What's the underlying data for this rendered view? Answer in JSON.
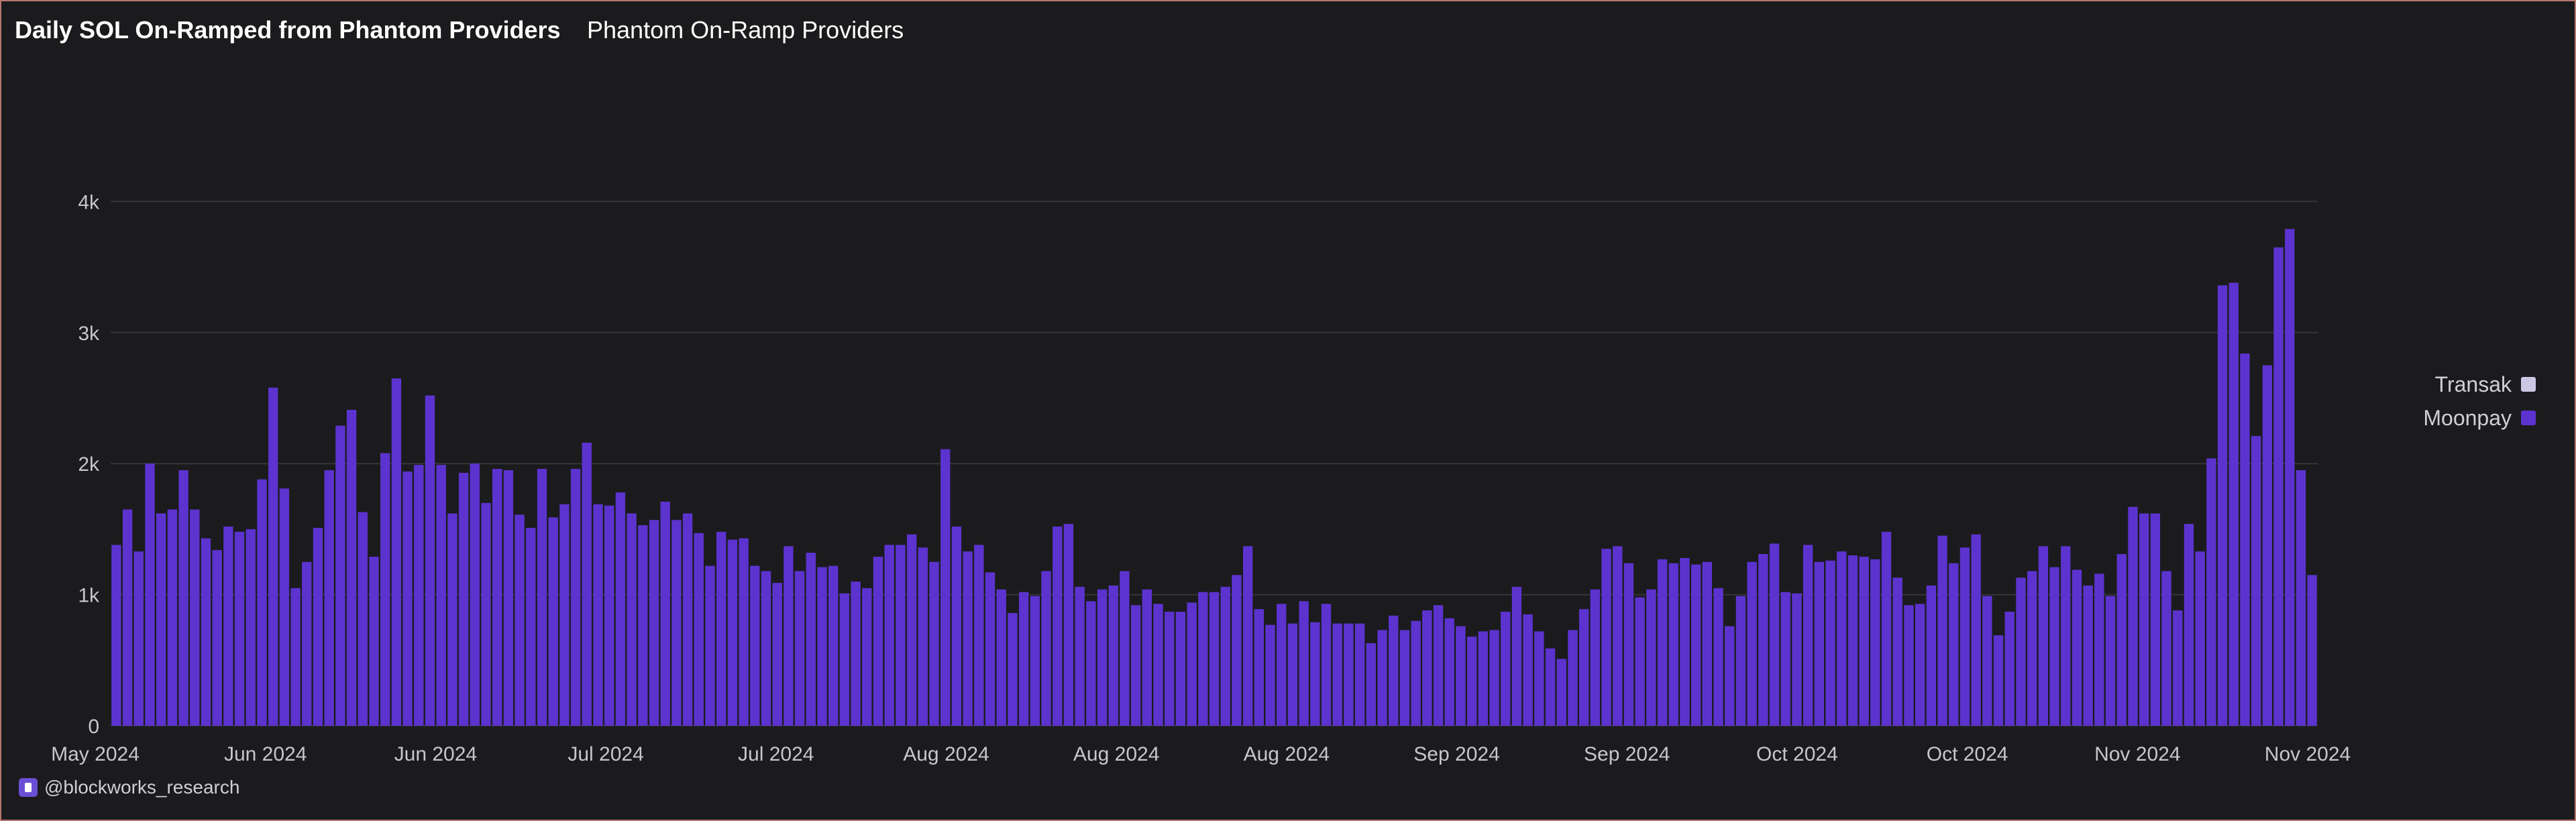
{
  "title": "Daily SOL On-Ramped from Phantom Providers",
  "subtitle": "Phantom On-Ramp Providers",
  "watermark": "@blockworks_research",
  "colors": {
    "background": "#1b1b1d",
    "grid": "#353538",
    "axis_text": "#c6c6cc",
    "moonpay": "#5c33cf",
    "transak": "#cbc6e4"
  },
  "chart_data": {
    "type": "bar",
    "stacked": true,
    "title": "Daily SOL On-Ramped from Phantom Providers",
    "subtitle": "Phantom On-Ramp Providers",
    "xlabel": "",
    "ylabel": "",
    "ylim": [
      0,
      5000
    ],
    "yticks": [
      0,
      1000,
      2000,
      3000,
      4000
    ],
    "ytick_labels": [
      "0",
      "1k",
      "2k",
      "3k",
      "4k"
    ],
    "xtick_labels": [
      "May 2024",
      "Jun 2024",
      "Jun 2024",
      "Jul 2024",
      "Jul 2024",
      "Aug 2024",
      "Aug 2024",
      "Aug 2024",
      "Sep 2024",
      "Sep 2024",
      "Oct 2024",
      "Oct 2024",
      "Nov 2024",
      "Nov 2024"
    ],
    "grid": true,
    "legend_position": "right",
    "series": [
      {
        "name": "Moonpay",
        "color": "#5c33cf",
        "values": [
          1380,
          1650,
          1330,
          2000,
          1620,
          1650,
          1950,
          1650,
          1430,
          1340,
          1520,
          1480,
          1500,
          1880,
          2580,
          1810,
          1050,
          1250,
          1510,
          1950,
          2290,
          2410,
          1630,
          1290,
          2080,
          2650,
          1940,
          1990,
          2520,
          1990,
          1620,
          1930,
          2000,
          1700,
          1960,
          1950,
          1610,
          1510,
          1960,
          1590,
          1690,
          1960,
          2160,
          1690,
          1680,
          1780,
          1620,
          1530,
          1570,
          1710,
          1570,
          1620,
          1470,
          1220,
          1480,
          1420,
          1430,
          1220,
          1180,
          1090,
          1370,
          1180,
          1320,
          1210,
          1220,
          1010,
          1100,
          1050,
          1290,
          1380,
          1380,
          1460,
          1360,
          1250,
          2110,
          1520,
          1330,
          1380,
          1170,
          1040,
          860,
          1020,
          990,
          1180,
          1520,
          1540,
          1060,
          950,
          1040,
          1070,
          1180,
          920,
          1040,
          930,
          870,
          870,
          940,
          1020,
          1020,
          1060,
          1150,
          1370,
          890,
          770,
          930,
          780,
          950,
          790,
          930,
          780,
          780,
          780,
          630,
          730,
          840,
          730,
          800,
          880,
          920,
          820,
          760,
          680,
          720,
          730,
          870,
          1060,
          850,
          720,
          590,
          510,
          730,
          890,
          1040,
          1350,
          1370,
          1240,
          980,
          1040,
          1270,
          1240,
          1280,
          1230,
          1250,
          1050,
          760,
          990,
          1250,
          1310,
          1390,
          1020,
          1010,
          1380,
          1250,
          1260,
          1330,
          1300,
          1290,
          1270,
          1480,
          1130,
          920,
          930,
          1070,
          1450,
          1240,
          1360,
          1460,
          990,
          690,
          870,
          1130,
          1180,
          1370,
          1210,
          1370,
          1190,
          1070,
          1160,
          990,
          1310,
          1670,
          1620,
          1620,
          1180,
          880,
          1540,
          1330,
          2040,
          3360,
          3380,
          2840,
          2210,
          2750,
          3650,
          3790,
          1950,
          1150
        ]
      },
      {
        "name": "Transak",
        "color": "#cbc6e4",
        "values": [
          0,
          0,
          0,
          0,
          0,
          0,
          0,
          0,
          0,
          0,
          0,
          0,
          0,
          0,
          0,
          0,
          0,
          0,
          0,
          0,
          0,
          0,
          0,
          0,
          0,
          0,
          0,
          0,
          0,
          0,
          0,
          0,
          0,
          0,
          0,
          0,
          0,
          0,
          0,
          0,
          0,
          0,
          0,
          0,
          0,
          0,
          0,
          0,
          0,
          0,
          0,
          0,
          0,
          0,
          0,
          0,
          0,
          0,
          0,
          0,
          0,
          0,
          0,
          0,
          0,
          0,
          0,
          0,
          0,
          0,
          0,
          0,
          0,
          0,
          0,
          0,
          0,
          0,
          0,
          0,
          0,
          0,
          0,
          0,
          0,
          0,
          0,
          0,
          0,
          0,
          0,
          0,
          0,
          0,
          0,
          0,
          0,
          0,
          0,
          0,
          0,
          0,
          0,
          0,
          0,
          0,
          0,
          0,
          0,
          0,
          0,
          0,
          0,
          0,
          0,
          0,
          0,
          0,
          0,
          0,
          0,
          0,
          0,
          0,
          0,
          0,
          0,
          0,
          0,
          0,
          0,
          0,
          0,
          0,
          0,
          0,
          0,
          0,
          0,
          0,
          0,
          0,
          0,
          0,
          0,
          0,
          0,
          0,
          0,
          0,
          0,
          0,
          0,
          0,
          0,
          0,
          0,
          0,
          0,
          0,
          0,
          0,
          0,
          0,
          0,
          0,
          0,
          0,
          0,
          0,
          0,
          0,
          0,
          0,
          0,
          0,
          0,
          0,
          0,
          0,
          0,
          0,
          0,
          0,
          0,
          0,
          0,
          0,
          0,
          0,
          0,
          0,
          0,
          0,
          0,
          0,
          0,
          0,
          0,
          0,
          0,
          0,
          0,
          0,
          0,
          0,
          0,
          0,
          0,
          0,
          0,
          0,
          0,
          0,
          0,
          0,
          0,
          0,
          0,
          0,
          0,
          0,
          0,
          0,
          0,
          0,
          0,
          0,
          0,
          0,
          0,
          0
        ]
      }
    ]
  }
}
